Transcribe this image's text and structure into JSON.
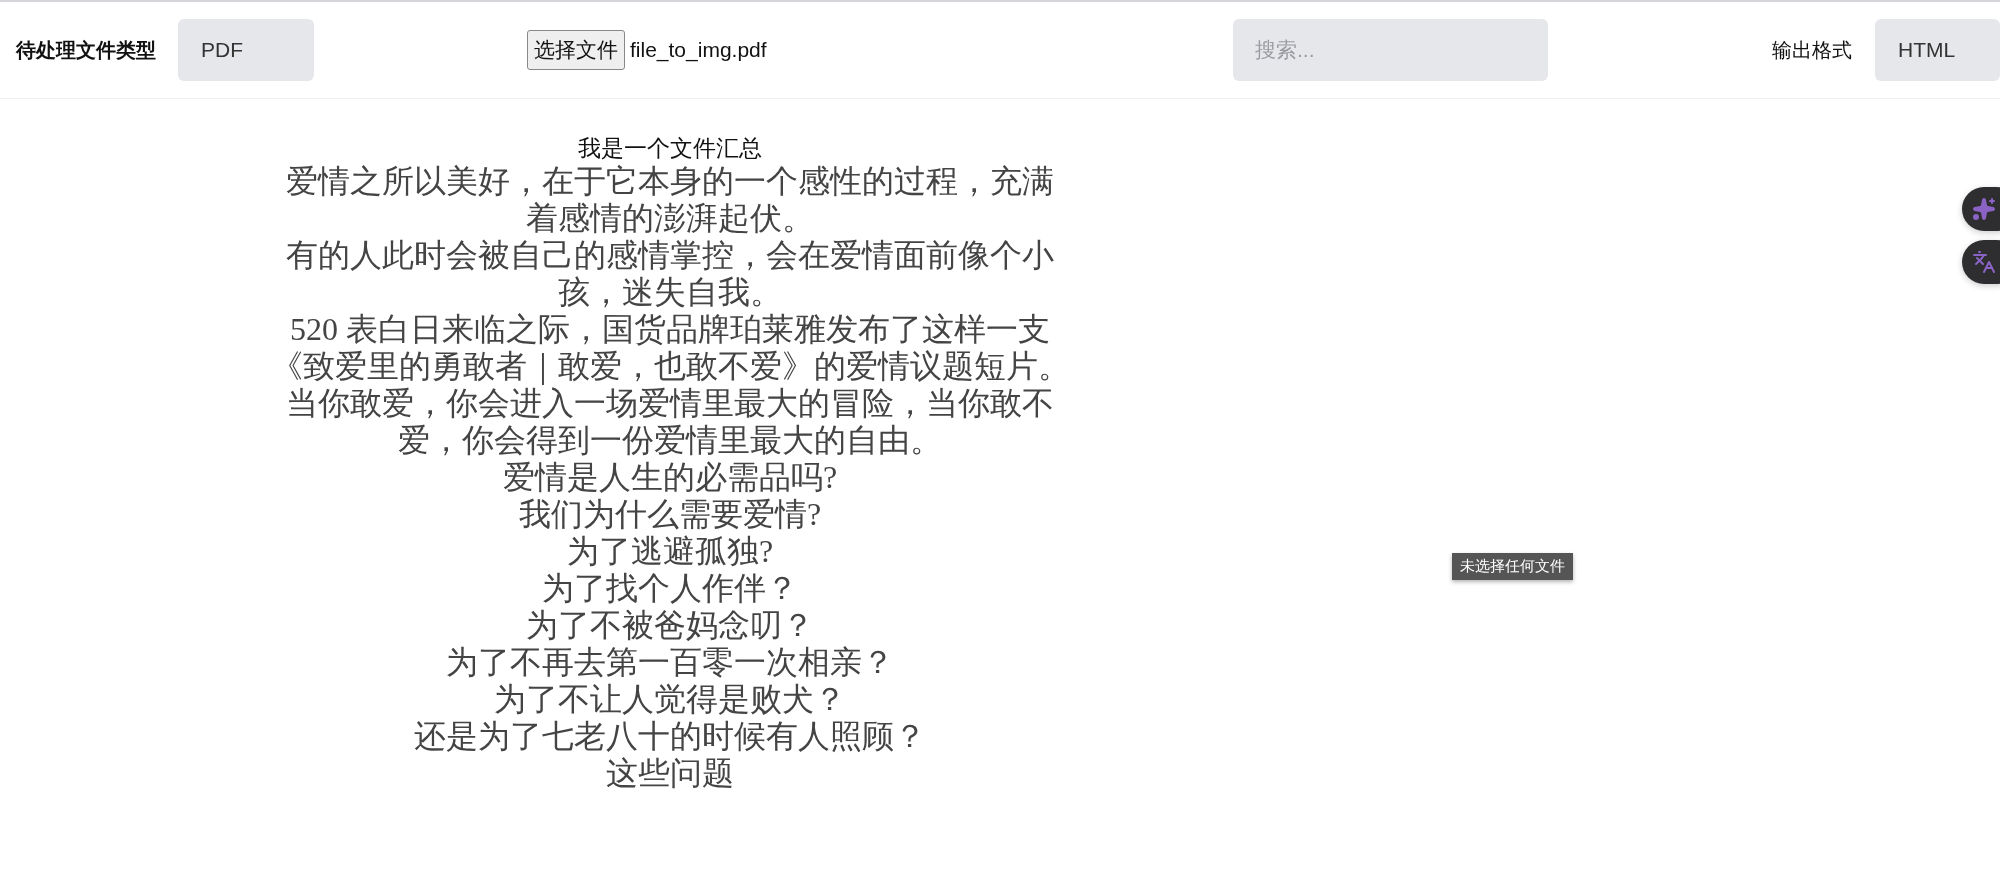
{
  "toolbar": {
    "input_type_label": "待处理文件类型",
    "input_type_value": "PDF",
    "file_button": "选择文件",
    "file_name": "file_to_img.pdf",
    "search": {
      "placeholder": "搜索..."
    },
    "output_format_label": "输出格式",
    "output_format_value": "HTML"
  },
  "document": {
    "title": "我是一个文件汇总",
    "lines": [
      "爱情之所以美好，在于它本身的一个感性的过程，充满",
      "着感情的澎湃起伏。",
      "有的人此时会被自己的感情掌控，会在爱情面前像个小",
      "孩，迷失自我。",
      "520 表白日来临之际，国货品牌珀莱雅发布了这样一支",
      "《致爱里的勇敢者｜敢爱，也敢不爱》的爱情议题短片。",
      "当你敢爱，你会进入一场爱情里最大的冒险，当你敢不",
      "爱，你会得到一份爱情里最大的自由。",
      "爱情是人生的必需品吗?",
      "我们为什么需要爱情?",
      "为了逃避孤独?",
      "为了找个人作伴？",
      "为了不被爸妈念叨？",
      "为了不再去第一百零一次相亲？",
      "为了不让人觉得是败犬？",
      "还是为了七老八十的时候有人照顾？",
      "这些问题"
    ]
  },
  "tooltip": "未选择任何文件",
  "floating_buttons": [
    {
      "kind": "ai"
    },
    {
      "kind": "translate"
    }
  ]
}
